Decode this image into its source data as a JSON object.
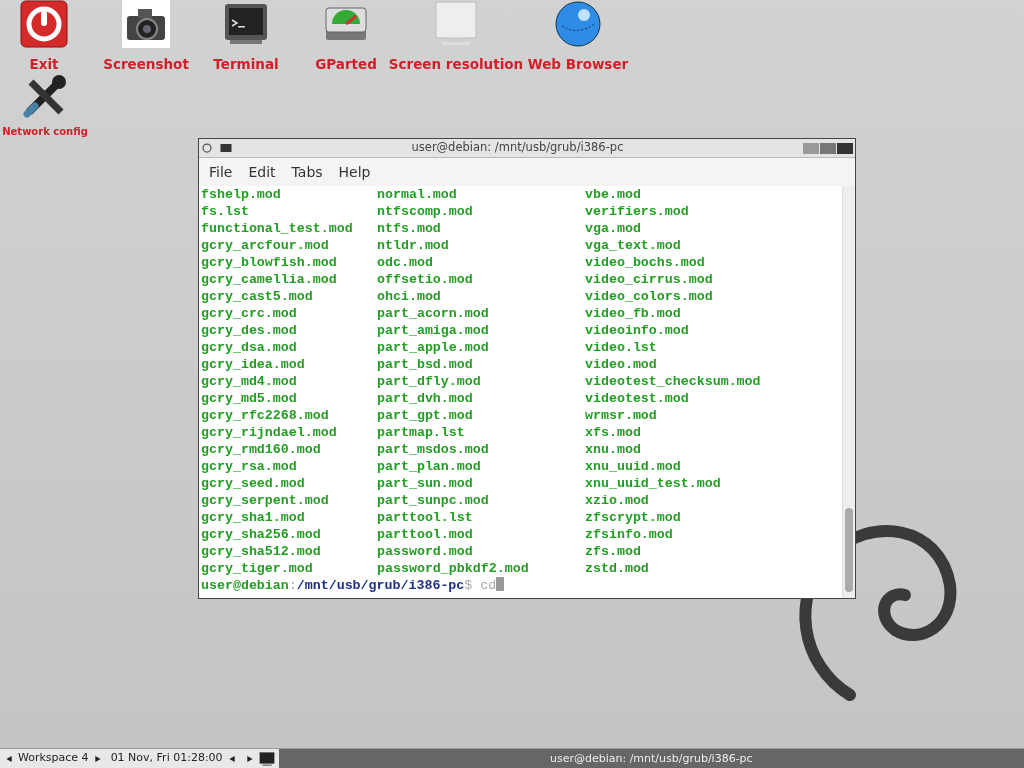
{
  "desktop_icons": [
    {
      "label": "Exit",
      "kind": "power"
    },
    {
      "label": "Screenshot",
      "kind": "camera"
    },
    {
      "label": "Terminal",
      "kind": "terminal"
    },
    {
      "label": "GParted",
      "kind": "disk"
    },
    {
      "label": "Screen resolution",
      "kind": "monitor"
    },
    {
      "label": "Web Browser",
      "kind": "globe"
    },
    {
      "label": "Network config",
      "kind": "tools"
    }
  ],
  "terminal": {
    "title": "user@debian: /mnt/usb/grub/i386-pc",
    "menu": [
      "File",
      "Edit",
      "Tabs",
      "Help"
    ],
    "listing": [
      [
        "fshelp.mod",
        "normal.mod",
        "vbe.mod"
      ],
      [
        "fs.lst",
        "ntfscomp.mod",
        "verifiers.mod"
      ],
      [
        "functional_test.mod",
        "ntfs.mod",
        "vga.mod"
      ],
      [
        "gcry_arcfour.mod",
        "ntldr.mod",
        "vga_text.mod"
      ],
      [
        "gcry_blowfish.mod",
        "odc.mod",
        "video_bochs.mod"
      ],
      [
        "gcry_camellia.mod",
        "offsetio.mod",
        "video_cirrus.mod"
      ],
      [
        "gcry_cast5.mod",
        "ohci.mod",
        "video_colors.mod"
      ],
      [
        "gcry_crc.mod",
        "part_acorn.mod",
        "video_fb.mod"
      ],
      [
        "gcry_des.mod",
        "part_amiga.mod",
        "videoinfo.mod"
      ],
      [
        "gcry_dsa.mod",
        "part_apple.mod",
        "video.lst"
      ],
      [
        "gcry_idea.mod",
        "part_bsd.mod",
        "video.mod"
      ],
      [
        "gcry_md4.mod",
        "part_dfly.mod",
        "videotest_checksum.mod"
      ],
      [
        "gcry_md5.mod",
        "part_dvh.mod",
        "videotest.mod"
      ],
      [
        "gcry_rfc2268.mod",
        "part_gpt.mod",
        "wrmsr.mod"
      ],
      [
        "gcry_rijndael.mod",
        "partmap.lst",
        "xfs.mod"
      ],
      [
        "gcry_rmd160.mod",
        "part_msdos.mod",
        "xnu.mod"
      ],
      [
        "gcry_rsa.mod",
        "part_plan.mod",
        "xnu_uuid.mod"
      ],
      [
        "gcry_seed.mod",
        "part_sun.mod",
        "xnu_uuid_test.mod"
      ],
      [
        "gcry_serpent.mod",
        "part_sunpc.mod",
        "xzio.mod"
      ],
      [
        "gcry_sha1.mod",
        "parttool.lst",
        "zfscrypt.mod"
      ],
      [
        "gcry_sha256.mod",
        "parttool.mod",
        "zfsinfo.mod"
      ],
      [
        "gcry_sha512.mod",
        "password.mod",
        "zfs.mod"
      ],
      [
        "gcry_tiger.mod",
        "password_pbkdf2.mod",
        "zstd.mod"
      ]
    ],
    "prompt": {
      "user": "user@debian",
      "separator": ":",
      "path": "/mnt/usb/grub/i386-pc",
      "symbol": "$",
      "command": "cd"
    }
  },
  "taskbar": {
    "workspace": "Workspace 4",
    "clock": "01 Nov, Fri 01:28:00",
    "task": "user@debian: /mnt/usb/grub/i386-pc"
  }
}
